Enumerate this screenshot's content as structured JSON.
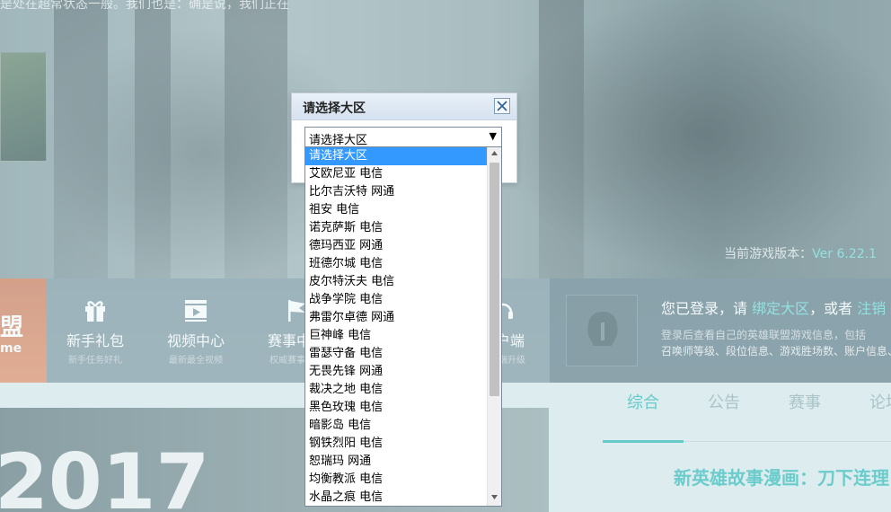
{
  "hero": {
    "top_text": "是处在超常状态一般。我们也是：确是说，我们正在",
    "version_label": "当前游戏版本：",
    "version_value": "Ver 6.22.1"
  },
  "nav": {
    "brand_glyph": "盟",
    "brand_text": "me",
    "items": [
      {
        "title": "新手礼包",
        "sub": "新手任务好礼",
        "icon": "gift-icon"
      },
      {
        "title": "视频中心",
        "sub": "最新最全视频",
        "icon": "video-icon"
      },
      {
        "title": "赛事中心",
        "sub": "权威赛事资讯",
        "icon": "flag-icon"
      },
      {
        "title": "客户端",
        "sub": "客户端升级",
        "icon": "headset-icon"
      }
    ]
  },
  "login": {
    "prefix": "您已登录，请 ",
    "bind_link": "绑定大区",
    "middle": "，或者 ",
    "logout_link": "注销",
    "desc": "登录后查看自己的英雄联盟游戏信息，包括",
    "desc2": "召唤师等级、段位信息、游戏胜场数、账户信息、"
  },
  "banner": {
    "year": "2017"
  },
  "tabs": [
    "综合",
    "公告",
    "赛事",
    "论坛"
  ],
  "news": {
    "title": "新英雄故事漫画：刀下连理"
  },
  "dialog": {
    "title": "请选择大区",
    "select_value": "请选择大区",
    "options": [
      "请选择大区",
      "艾欧尼亚 电信",
      "比尔吉沃特 网通",
      "祖安 电信",
      "诺克萨斯 电信",
      "德玛西亚 网通",
      "班德尔城 电信",
      "皮尔特沃夫 电信",
      "战争学院 电信",
      "弗雷尔卓德 网通",
      "巨神峰 电信",
      "雷瑟守备 电信",
      "无畏先锋 网通",
      "裁决之地 电信",
      "黑色玫瑰 电信",
      "暗影岛 电信",
      "钢铁烈阳 电信",
      "恕瑞玛 网通",
      "均衡教派 电信",
      "水晶之痕 电信"
    ],
    "selected_index": 0
  },
  "colors": {
    "accent": "#43c2bf",
    "selection": "#3399ff"
  }
}
